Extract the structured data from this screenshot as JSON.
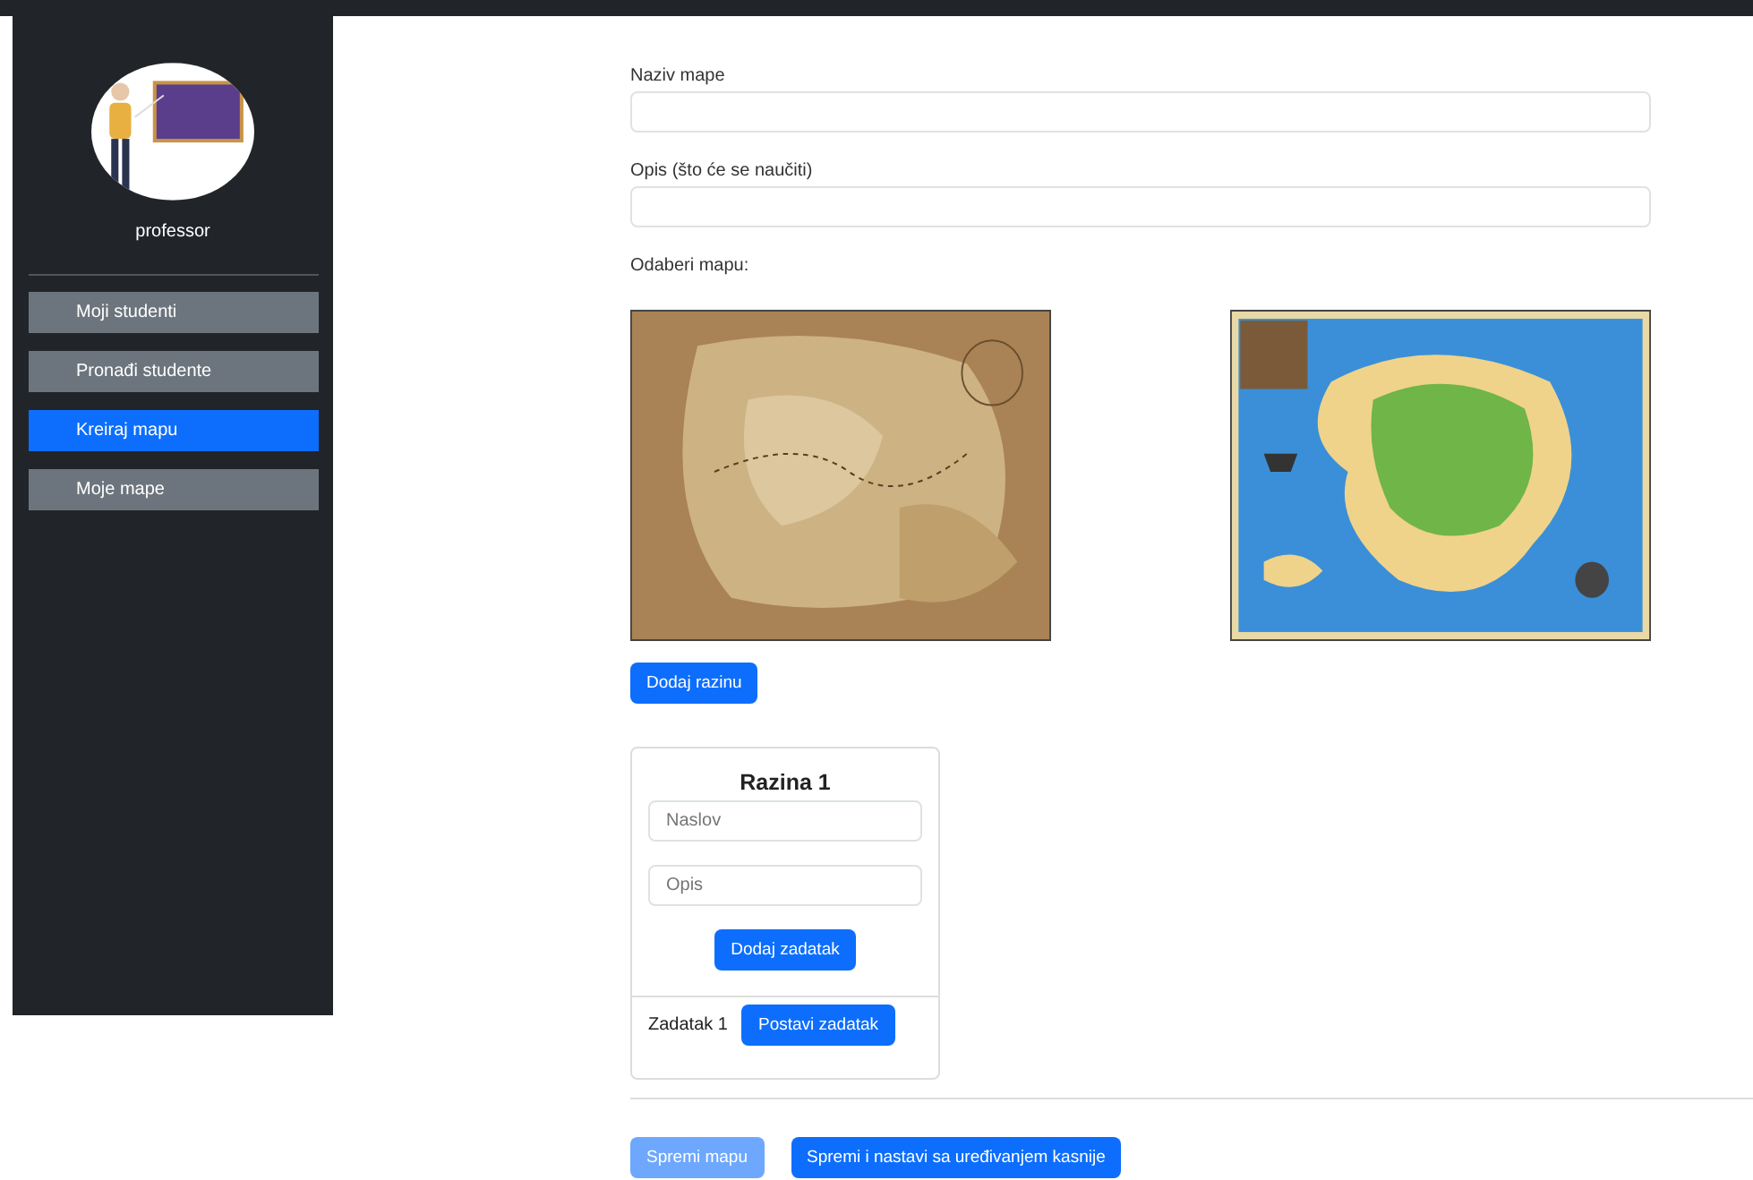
{
  "sidebar": {
    "username": "professor",
    "items": [
      {
        "label": "Moji studenti",
        "selected": false
      },
      {
        "label": "Pronađi studente",
        "selected": false
      },
      {
        "label": "Kreiraj mapu",
        "selected": true
      },
      {
        "label": "Moje mape",
        "selected": false
      }
    ]
  },
  "form": {
    "fields": [
      {
        "label": "Naziv mape"
      },
      {
        "label": "Opis (što će se naučiti)"
      }
    ],
    "map_label": "Odaberi mapu:",
    "add_level_button": "Dodaj razinu",
    "levels": [
      {
        "title": "Razina 1",
        "title_placeholder": "Naslov",
        "description_placeholder": "Opis",
        "add_task_button": "Dodaj zadatak",
        "tasks": [
          {
            "label": "Zadatak 1",
            "button": "Postavi zadatak"
          }
        ]
      }
    ],
    "actions": [
      {
        "label": "Spremi mapu",
        "disabled": true
      },
      {
        "label": "Spremi i nastavi sa uređivanjem kasnije",
        "disabled": false
      }
    ]
  }
}
